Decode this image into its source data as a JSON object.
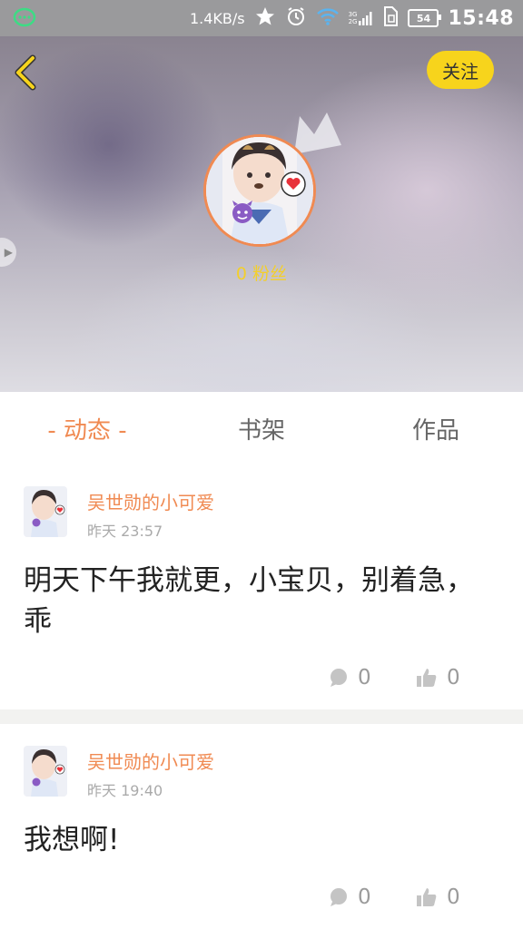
{
  "status_bar": {
    "net_speed": "1.4KB/s",
    "signal_labels": [
      "3G",
      "2G"
    ],
    "battery": "54",
    "time": "15:48"
  },
  "header": {
    "follow_label": "关注",
    "fans_text": "0 粉丝"
  },
  "tabs": [
    {
      "label": "- 动态 -",
      "active": true
    },
    {
      "label": "书架",
      "active": false
    },
    {
      "label": "作品",
      "active": false
    }
  ],
  "posts": [
    {
      "author": "吴世勋的小可爱",
      "time": "昨天 23:57",
      "text": "明天下午我就更，小宝贝，别着急，乖",
      "comments": "0",
      "likes": "0"
    },
    {
      "author": "吴世勋的小可爱",
      "time": "昨天 19:40",
      "text": "我想啊!",
      "comments": "0",
      "likes": "0"
    }
  ],
  "colors": {
    "accent": "#f08a52",
    "follow_bg": "#f7d41c",
    "fans_text": "#f3cf2b",
    "action_gray": "#9b9b9b"
  }
}
